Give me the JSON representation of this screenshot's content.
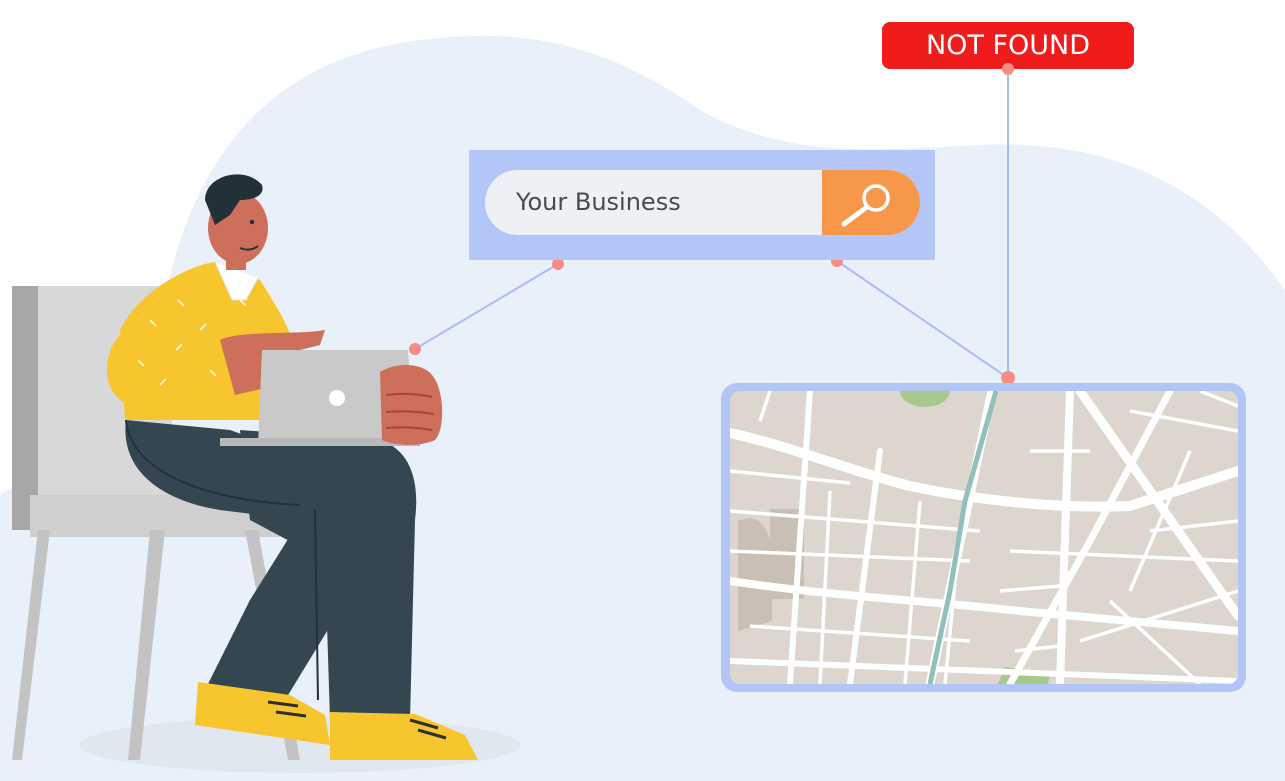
{
  "search": {
    "query": "Your Business",
    "button_icon": "search-icon"
  },
  "status_badge": {
    "label": "NOT FOUND",
    "color": "#f01c1c"
  },
  "colors": {
    "background_blob": "#e9f0f9",
    "panel": "#b3c6f7",
    "search_button": "#f7974a",
    "connector": "#a9bdf2",
    "connector_dot": "#f58d83",
    "map_frame": "#b1c6f5",
    "map_land": "#dcd6cf",
    "map_river": "#8fc0bd",
    "map_park": "#a8c98c",
    "shirt": "#f7c62f",
    "pants": "#344650",
    "skin": "#cd6f5a"
  },
  "map_icon": "city-map",
  "laptop_icon": "laptop-icon"
}
